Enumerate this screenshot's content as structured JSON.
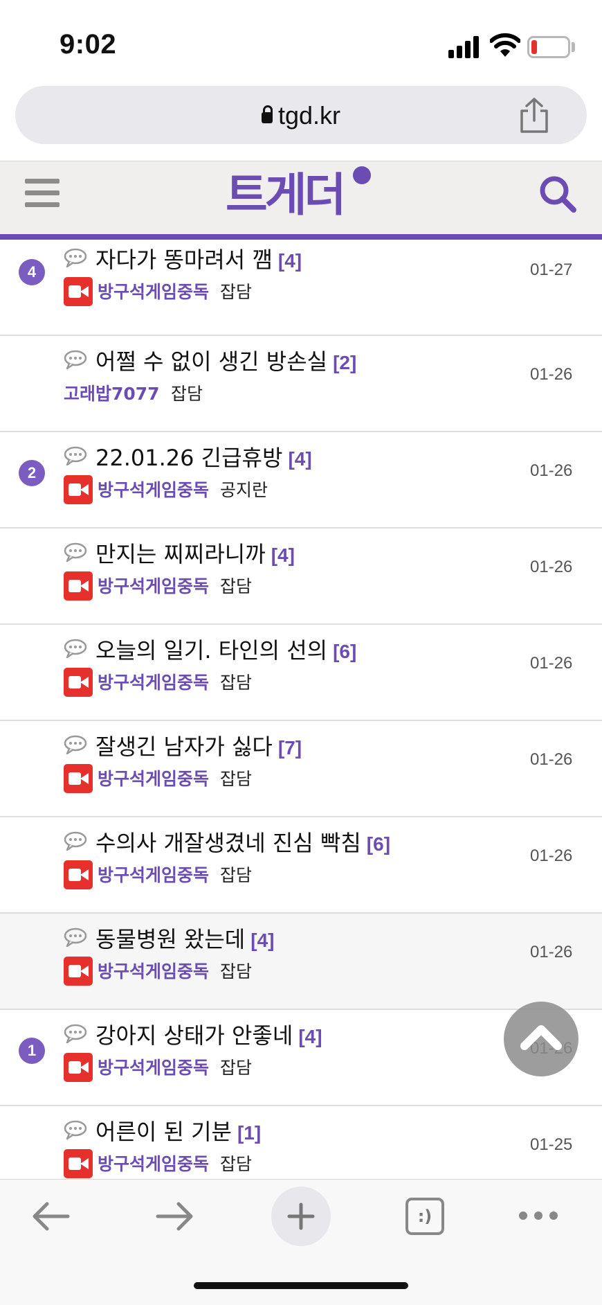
{
  "status_bar": {
    "time": "9:02"
  },
  "browser": {
    "url": "tgd.kr"
  },
  "site": {
    "logo_text": "트게더",
    "accent_color": "#6b4cb3"
  },
  "posts": [
    {
      "rank": "4",
      "title": "자다가 똥마려서 깸",
      "count": "[4]",
      "author": "방구석게임중독",
      "board": "잡담",
      "date": "01-27",
      "has_icon": true
    },
    {
      "rank": "",
      "title": "어쩔 수 없이 생긴 방손실",
      "count": "[2]",
      "author": "고래밥7077",
      "board": "잡담",
      "date": "01-26",
      "has_icon": false
    },
    {
      "rank": "2",
      "title": "22.01.26 긴급휴방",
      "count": "[4]",
      "author": "방구석게임중독",
      "board": "공지란",
      "date": "01-26",
      "has_icon": true
    },
    {
      "rank": "",
      "title": "만지는 찌찌라니까",
      "count": "[4]",
      "author": "방구석게임중독",
      "board": "잡담",
      "date": "01-26",
      "has_icon": true
    },
    {
      "rank": "",
      "title": "오늘의 일기. 타인의 선의",
      "count": "[6]",
      "author": "방구석게임중독",
      "board": "잡담",
      "date": "01-26",
      "has_icon": true
    },
    {
      "rank": "",
      "title": "잘생긴 남자가 싫다",
      "count": "[7]",
      "author": "방구석게임중독",
      "board": "잡담",
      "date": "01-26",
      "has_icon": true
    },
    {
      "rank": "",
      "title": "수의사 개잘생겼네 진심 빡침",
      "count": "[6]",
      "author": "방구석게임중독",
      "board": "잡담",
      "date": "01-26",
      "has_icon": true
    },
    {
      "rank": "",
      "title": "동물병원 왔는데",
      "count": "[4]",
      "author": "방구석게임중독",
      "board": "잡담",
      "date": "01-26",
      "has_icon": true
    },
    {
      "rank": "1",
      "title": "강아지 상태가 안좋네",
      "count": "[4]",
      "author": "방구석게임중독",
      "board": "잡담",
      "date": "01-26",
      "has_icon": true
    },
    {
      "rank": "",
      "title": "어른이 된 기분",
      "count": "[1]",
      "author": "방구석게임중독",
      "board": "잡담",
      "date": "01-25",
      "has_icon": true
    }
  ],
  "toolbar": {
    "tabs_glyph": ":)"
  }
}
